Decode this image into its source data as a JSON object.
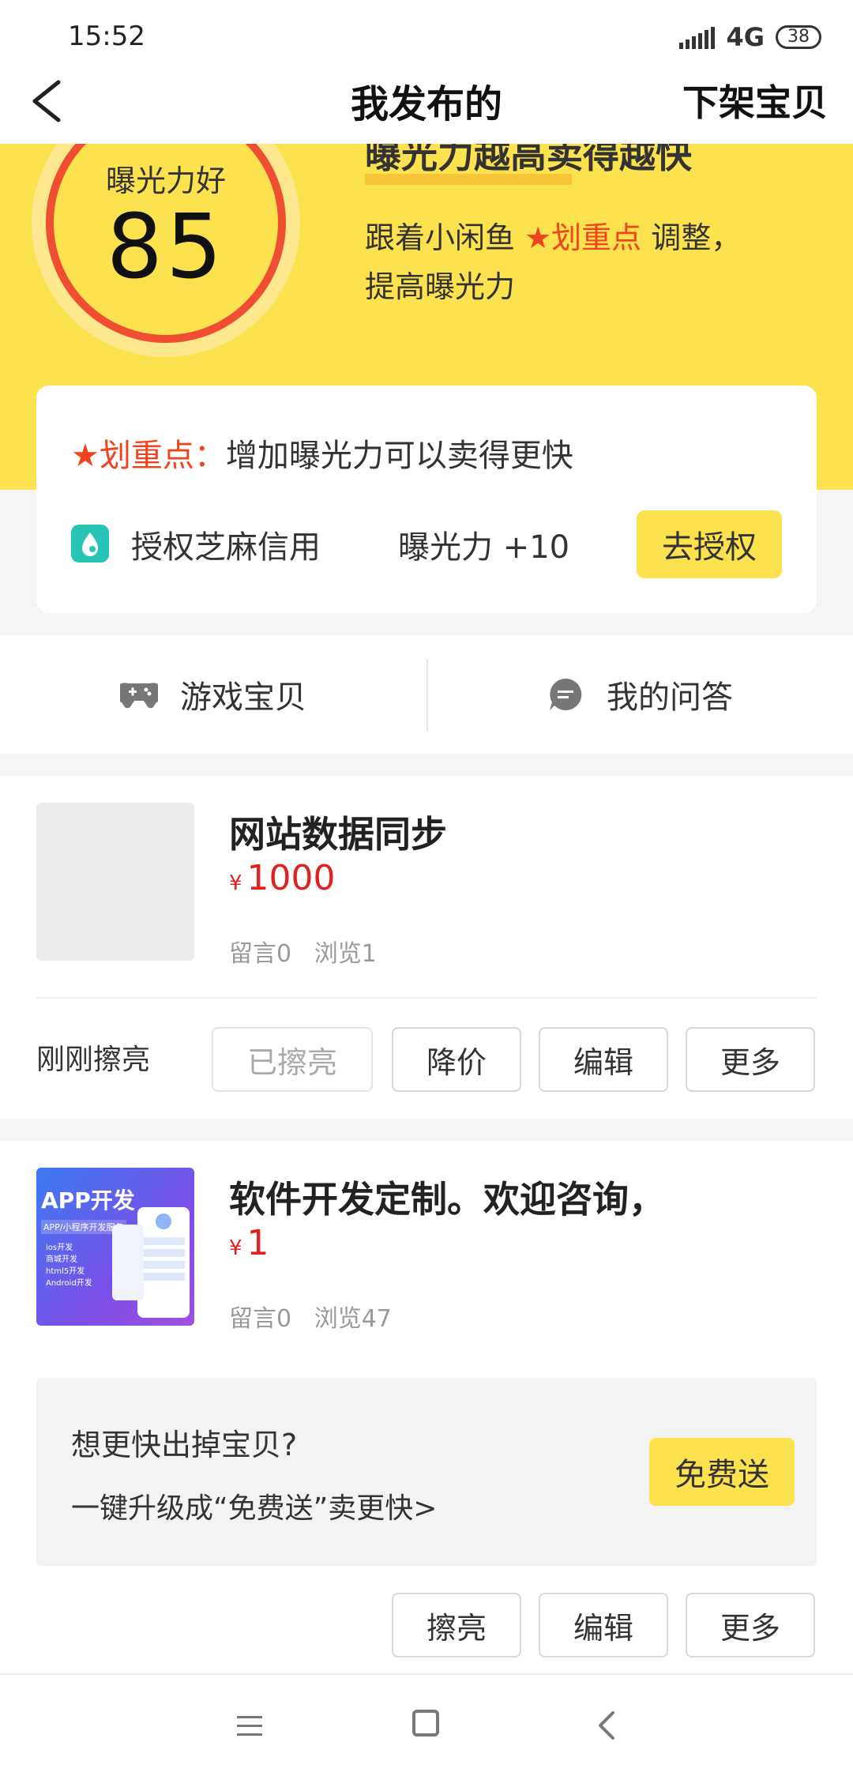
{
  "status_bar": {
    "time": "15:52",
    "network": "4G",
    "battery": "38"
  },
  "header": {
    "title": "我发布的",
    "right_action": "下架宝贝"
  },
  "exposure": {
    "label": "曝光力好",
    "score": "85",
    "heading": "曝光力越高卖得越快",
    "desc_prefix": "跟着小闲鱼 ",
    "desc_highlight": "★划重点",
    "desc_suffix": " 调整，",
    "desc_line2": "提高曝光力"
  },
  "tip_card": {
    "label": "★划重点：",
    "text": "增加曝光力可以卖得更快",
    "action_title": "授权芝麻信用",
    "boost": "曝光力 +10",
    "button": "去授权"
  },
  "shortcuts": {
    "games": "游戏宝贝",
    "qa": "我的问答"
  },
  "listings": [
    {
      "title": "网站数据同步",
      "currency": "¥",
      "price": "1000",
      "comments": "留言0",
      "views": "浏览1",
      "status": "刚刚擦亮",
      "buttons": [
        "已擦亮",
        "降价",
        "编辑",
        "更多"
      ]
    },
    {
      "title": "软件开发定制。欢迎咨询，",
      "currency": "¥",
      "price": "1",
      "comments": "留言0",
      "views": "浏览47",
      "thumb_title": "APP开发",
      "thumb_sub": "APP/小程序开发服务",
      "thumb_items": [
        "ios开发",
        "商城开发",
        "html5开发",
        "Android开发"
      ],
      "promo": {
        "question": "想更快出掉宝贝?",
        "subtitle": "一键升级成“免费送”卖更快>",
        "button": "免费送"
      },
      "buttons": [
        "擦亮",
        "编辑",
        "更多"
      ]
    }
  ],
  "colors": {
    "brand_yellow": "#fde24f",
    "accent_red": "#f0441e",
    "price_red": "#e0221f"
  }
}
